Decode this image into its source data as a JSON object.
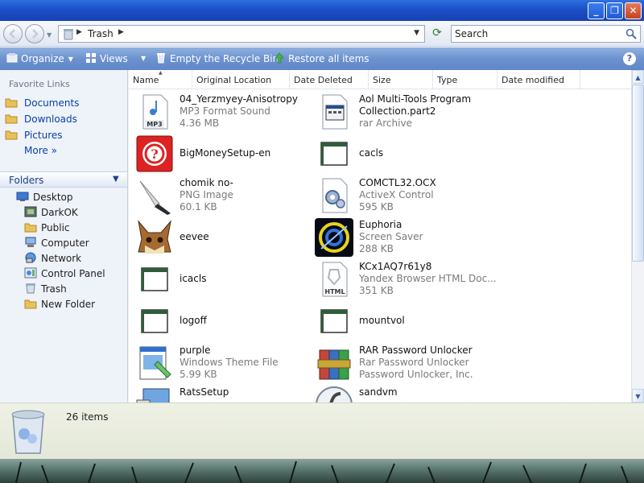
{
  "window": {
    "min_label": "_",
    "max_label": "❐",
    "close_label": "✕"
  },
  "address": {
    "crumb": "Trash",
    "search_placeholder": "Search"
  },
  "commandbar": {
    "organize": "Organize",
    "views": "Views",
    "empty": "Empty the Recycle Bin",
    "restore": "Restore all items",
    "help": "?"
  },
  "nav": {
    "favorites_title": "Favorite Links",
    "favorites": [
      "Documents",
      "Downloads",
      "Pictures"
    ],
    "more": "More",
    "folders_title": "Folders",
    "tree": [
      "Desktop",
      "DarkOK",
      "Public",
      "Computer",
      "Network",
      "Control Panel",
      "Trash",
      "New Folder"
    ]
  },
  "columns": [
    "Name",
    "Original Location",
    "Date Deleted",
    "Size",
    "Type",
    "Date modified"
  ],
  "items": [
    {
      "name": "04_Yerzmyey-Anisotropy",
      "line2": "MP3 Format Sound",
      "line3": "4.36 MB",
      "icon": "mp3-icon"
    },
    {
      "name": "Aol Multi-Tools Program",
      "line2": "Collection.part2",
      "line3": "rar Archive",
      "icon": "window-icon"
    },
    {
      "name": "BigMoneySetup-en",
      "icon": "bigmoney-icon"
    },
    {
      "name": "cacls",
      "icon": "console-icon"
    },
    {
      "name": "chomik no-",
      "line2": "PNG Image",
      "line3": "60.1 KB",
      "icon": "knife-icon"
    },
    {
      "name": "COMCTL32.OCX",
      "line2": "ActiveX Control",
      "line3": "595 KB",
      "icon": "gear-file-icon"
    },
    {
      "name": "eevee",
      "icon": "eevee-icon"
    },
    {
      "name": "Euphoria",
      "line2": "Screen Saver",
      "line3": "288 KB",
      "icon": "euphoria-icon"
    },
    {
      "name": "icacls",
      "icon": "console-icon"
    },
    {
      "name": "KCx1AQ7r61y8",
      "line2": "Yandex Browser HTML Doc...",
      "line3": "351 KB",
      "icon": "html-file-icon"
    },
    {
      "name": "logoff",
      "icon": "console-icon"
    },
    {
      "name": "mountvol",
      "icon": "console-icon"
    },
    {
      "name": "purple",
      "line2": "Windows Theme File",
      "line3": "5.99 KB",
      "icon": "theme-icon"
    },
    {
      "name": "RAR Password Unlocker",
      "line2": "Rar Password Unlocker",
      "line3": "Password Unlocker, Inc.",
      "icon": "winrar-icon"
    },
    {
      "name": "RatsSetup",
      "icon": "computer-setup-icon"
    },
    {
      "name": "sandvm",
      "icon": "flash-icon"
    }
  ],
  "details": {
    "count": "26 items"
  }
}
